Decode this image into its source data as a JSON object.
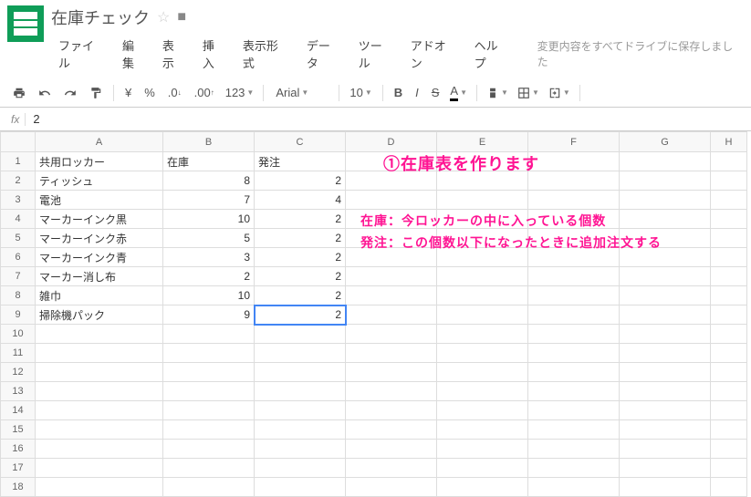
{
  "title": "在庫チェック",
  "menu": [
    "ファイル",
    "編集",
    "表示",
    "挿入",
    "表示形式",
    "データ",
    "ツール",
    "アドオン",
    "ヘルプ"
  ],
  "save_status": "変更内容をすべてドライブに保存しました",
  "toolbar": {
    "currency": "¥",
    "percent": "%",
    "dec_dec": ".0",
    "dec_inc": ".00",
    "num_fmt": "123",
    "font": "Arial",
    "size": "10",
    "bold": "B",
    "italic": "I",
    "strike": "S",
    "text_color": "A"
  },
  "formula": {
    "label": "fx",
    "value": "2"
  },
  "columns": [
    "A",
    "B",
    "C",
    "D",
    "E",
    "F",
    "G",
    "H"
  ],
  "rows": [
    {
      "n": "1",
      "A": "共用ロッカー",
      "B": "在庫",
      "C": "発注"
    },
    {
      "n": "2",
      "A": "ティッシュ",
      "B": "8",
      "C": "2"
    },
    {
      "n": "3",
      "A": "電池",
      "B": "7",
      "C": "4"
    },
    {
      "n": "4",
      "A": "マーカーインク黒",
      "B": "10",
      "C": "2"
    },
    {
      "n": "5",
      "A": "マーカーインク赤",
      "B": "5",
      "C": "2"
    },
    {
      "n": "6",
      "A": "マーカーインク青",
      "B": "3",
      "C": "2"
    },
    {
      "n": "7",
      "A": "マーカー消し布",
      "B": "2",
      "C": "2"
    },
    {
      "n": "8",
      "A": "雑巾",
      "B": "10",
      "C": "2"
    },
    {
      "n": "9",
      "A": "掃除機パック",
      "B": "9",
      "C": "2"
    },
    {
      "n": "10"
    },
    {
      "n": "11"
    },
    {
      "n": "12"
    },
    {
      "n": "13"
    },
    {
      "n": "14"
    },
    {
      "n": "15"
    },
    {
      "n": "16"
    },
    {
      "n": "17"
    },
    {
      "n": "18"
    }
  ],
  "selected_cell": "C9",
  "annotations": {
    "a1": "①在庫表を作ります",
    "a2": "在庫：今ロッカーの中に入っている個数",
    "a3": "発注：この個数以下になったときに追加注文する"
  }
}
